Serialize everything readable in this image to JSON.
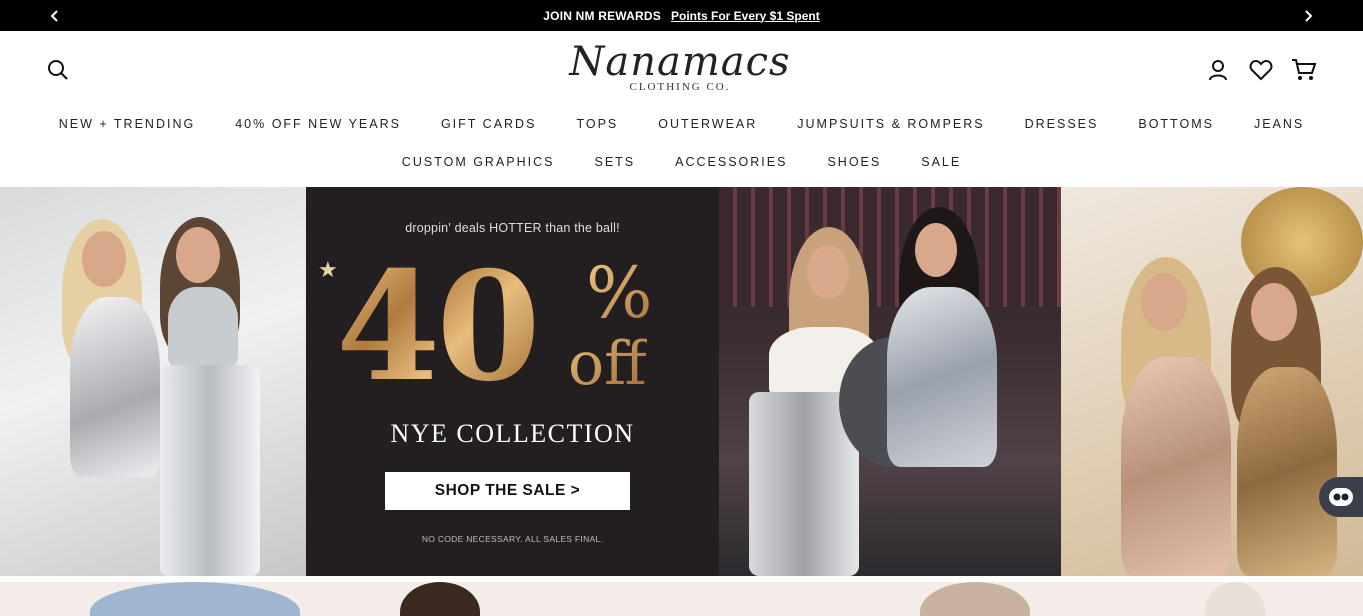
{
  "announcement": {
    "lead": "JOIN NM REWARDS",
    "link": "Points For Every $1 Spent"
  },
  "header": {
    "logo_script": "Nanamacs",
    "logo_sub": "CLOTHING CO."
  },
  "nav": {
    "row1": [
      "NEW + TRENDING",
      "40% OFF NEW YEARS",
      "GIFT CARDS",
      "TOPS",
      "OUTERWEAR",
      "JUMPSUITS & ROMPERS",
      "DRESSES",
      "BOTTOMS",
      "JEANS"
    ],
    "row2": [
      "CUSTOM GRAPHICS",
      "SETS",
      "ACCESSORIES",
      "SHOES",
      "SALE"
    ]
  },
  "hero": {
    "tagline": "droppin' deals HOTTER than the ball!",
    "percent_number": "40",
    "percent_sign": "%",
    "off": "off",
    "headline": "NYE COLLECTION",
    "cta": "SHOP THE SALE >",
    "fineprint": "NO CODE NECESSARY. ALL SALES FINAL."
  },
  "icons": [
    "search-icon",
    "account-icon",
    "heart-icon",
    "cart-icon",
    "chevron-left-icon",
    "chevron-right-icon",
    "chat-bot-icon"
  ],
  "colors": {
    "announce_bg": "#000000",
    "hero_dark": "#231f20",
    "gold": "#c9985a"
  }
}
